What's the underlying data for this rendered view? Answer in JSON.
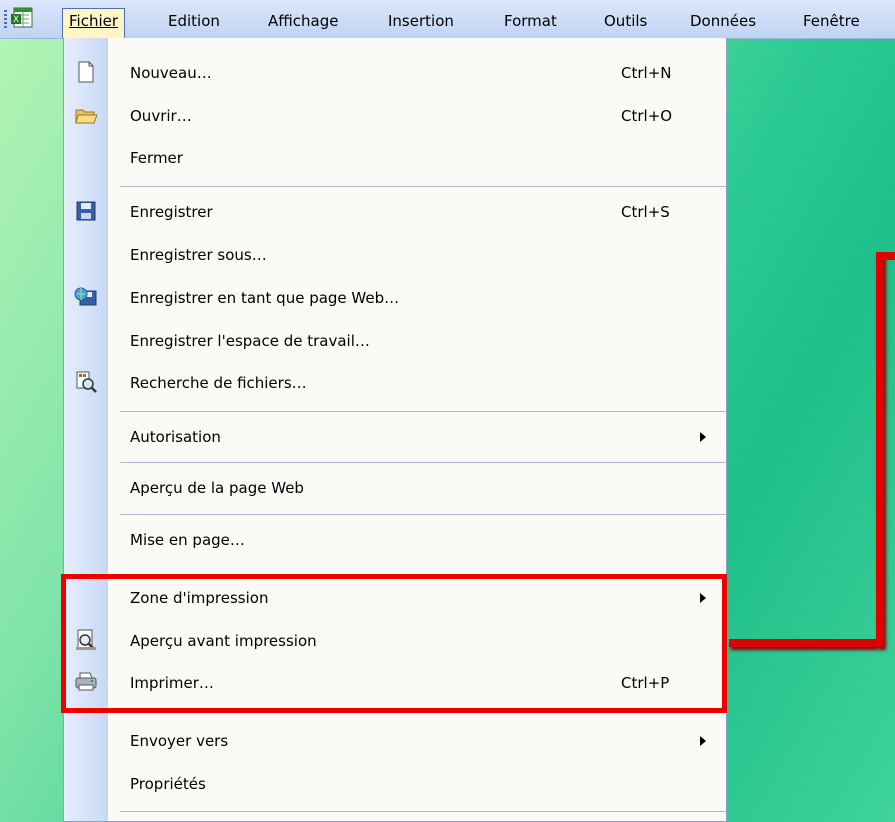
{
  "menubar": {
    "items": [
      {
        "label": "Fichier"
      },
      {
        "label": "Edition"
      },
      {
        "label": "Affichage"
      },
      {
        "label": "Insertion"
      },
      {
        "label": "Format"
      },
      {
        "label": "Outils"
      },
      {
        "label": "Données"
      },
      {
        "label": "Fenêtre"
      }
    ]
  },
  "dropdown": {
    "items": [
      {
        "label": "Nouveau…",
        "shortcut": "Ctrl+N",
        "icon": "new-document-icon"
      },
      {
        "label": "Ouvrir…",
        "shortcut": "Ctrl+O",
        "icon": "open-folder-icon"
      },
      {
        "label": "Fermer"
      },
      {
        "label": "Enregistrer",
        "shortcut": "Ctrl+S",
        "icon": "save-disk-icon"
      },
      {
        "label": "Enregistrer sous…"
      },
      {
        "label": "Enregistrer en tant que page Web…",
        "icon": "web-page-icon"
      },
      {
        "label": "Enregistrer l'espace de travail…"
      },
      {
        "label": "Recherche de fichiers…",
        "icon": "file-search-icon"
      },
      {
        "label": "Autorisation",
        "submenu": true
      },
      {
        "label": "Aperçu de la page Web"
      },
      {
        "label": "Mise en page…"
      },
      {
        "label": "Zone d'impression",
        "submenu": true
      },
      {
        "label": "Aperçu avant impression",
        "icon": "print-preview-icon"
      },
      {
        "label": "Imprimer…",
        "shortcut": "Ctrl+P",
        "icon": "printer-icon"
      },
      {
        "label": "Envoyer vers",
        "submenu": true
      },
      {
        "label": "Propriétés"
      }
    ]
  },
  "colors": {
    "highlight": "#ee0000",
    "menubar": "#c1d3f4",
    "gutter": "#c8d8f4"
  }
}
